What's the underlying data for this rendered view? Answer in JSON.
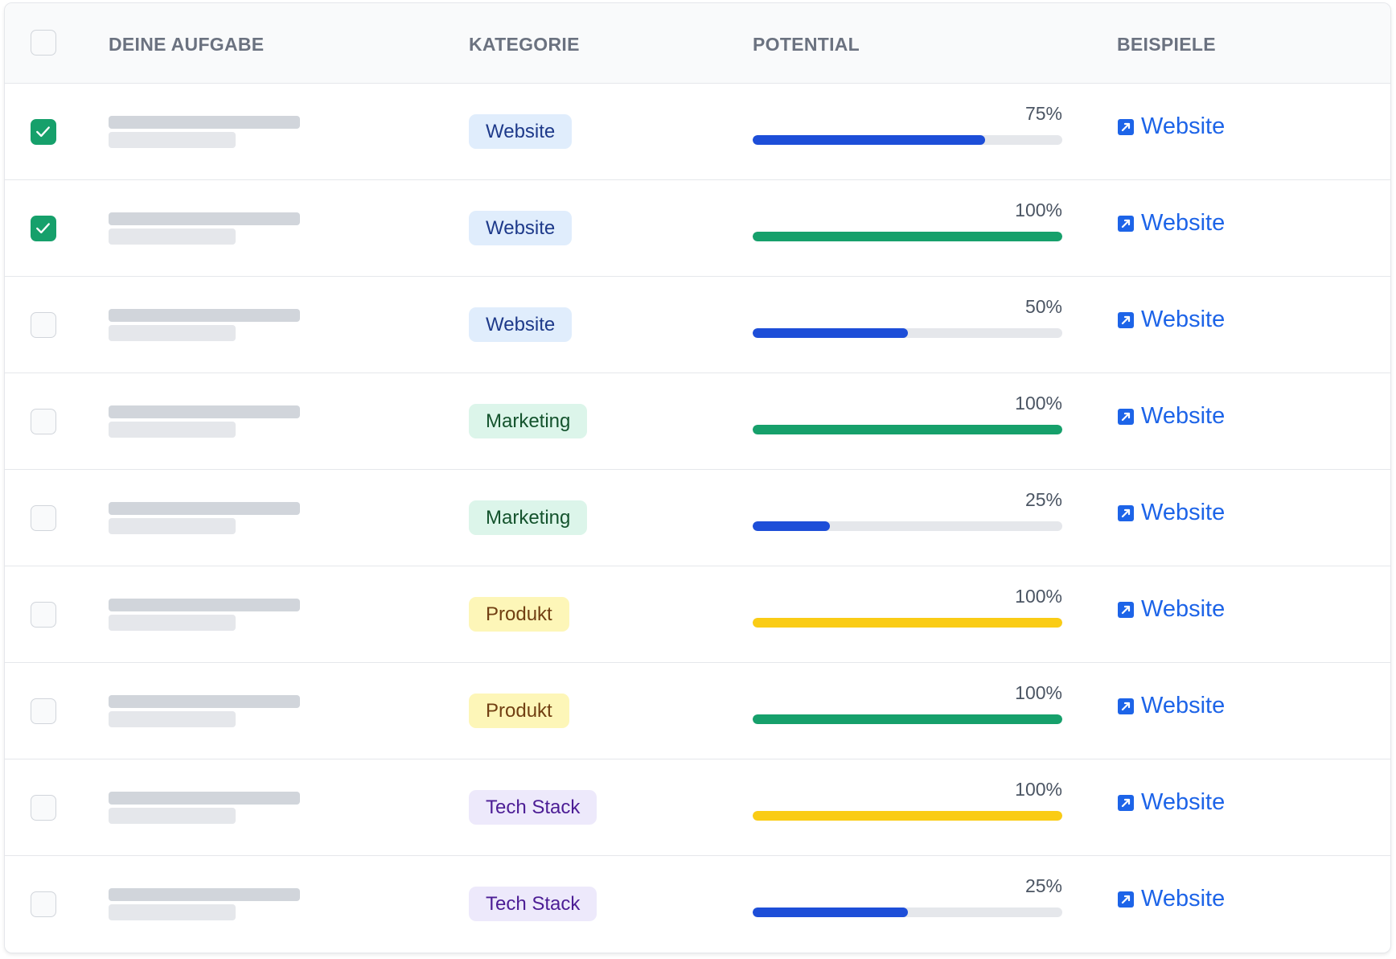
{
  "table": {
    "headers": {
      "task": "DEINE AUFGABE",
      "category": "KATEGORIE",
      "potential": "POTENTIAL",
      "examples": "BEISPIELE"
    },
    "rows": [
      {
        "checked": true,
        "category": "Website",
        "category_style": "website",
        "potential_percent": 75,
        "potential_label": "75%",
        "bar_color": "blue",
        "link": "Website"
      },
      {
        "checked": true,
        "category": "Website",
        "category_style": "website",
        "potential_percent": 100,
        "potential_label": "100%",
        "bar_color": "green",
        "link": "Website"
      },
      {
        "checked": false,
        "category": "Website",
        "category_style": "website",
        "potential_percent": 50,
        "potential_label": "50%",
        "bar_color": "blue",
        "link": "Website"
      },
      {
        "checked": false,
        "category": "Marketing",
        "category_style": "marketing",
        "potential_percent": 100,
        "potential_label": "100%",
        "bar_color": "green",
        "link": "Website"
      },
      {
        "checked": false,
        "category": "Marketing",
        "category_style": "marketing",
        "potential_percent": 25,
        "potential_label": "25%",
        "bar_color": "blue",
        "link": "Website"
      },
      {
        "checked": false,
        "category": "Produkt",
        "category_style": "produkt",
        "potential_percent": 100,
        "potential_label": "100%",
        "bar_color": "yellow",
        "link": "Website"
      },
      {
        "checked": false,
        "category": "Produkt",
        "category_style": "produkt",
        "potential_percent": 100,
        "potential_label": "100%",
        "bar_color": "green",
        "link": "Website"
      },
      {
        "checked": false,
        "category": "Tech Stack",
        "category_style": "techstack",
        "potential_percent": 100,
        "potential_label": "100%",
        "bar_color": "yellow",
        "link": "Website"
      },
      {
        "checked": false,
        "category": "Tech Stack",
        "category_style": "techstack",
        "potential_percent": 50,
        "potential_label": "25%",
        "bar_color": "blue",
        "link": "Website"
      }
    ]
  },
  "colors": {
    "checkbox_checked": "#16a06b",
    "bars": {
      "blue": "#1d4ed8",
      "green": "#16a06b",
      "yellow": "#facc15"
    },
    "link": "#1d64e8",
    "categories": {
      "website": {
        "bg": "#e0edfc",
        "fg": "#1e3a8a"
      },
      "marketing": {
        "bg": "#dcf5ea",
        "fg": "#14532d"
      },
      "produkt": {
        "bg": "#fdf6b8",
        "fg": "#713f12"
      },
      "techstack": {
        "bg": "#ede9fb",
        "fg": "#4c1d95"
      }
    }
  },
  "icons": {
    "checkbox_check": "check-icon",
    "link": "external-link-icon"
  }
}
